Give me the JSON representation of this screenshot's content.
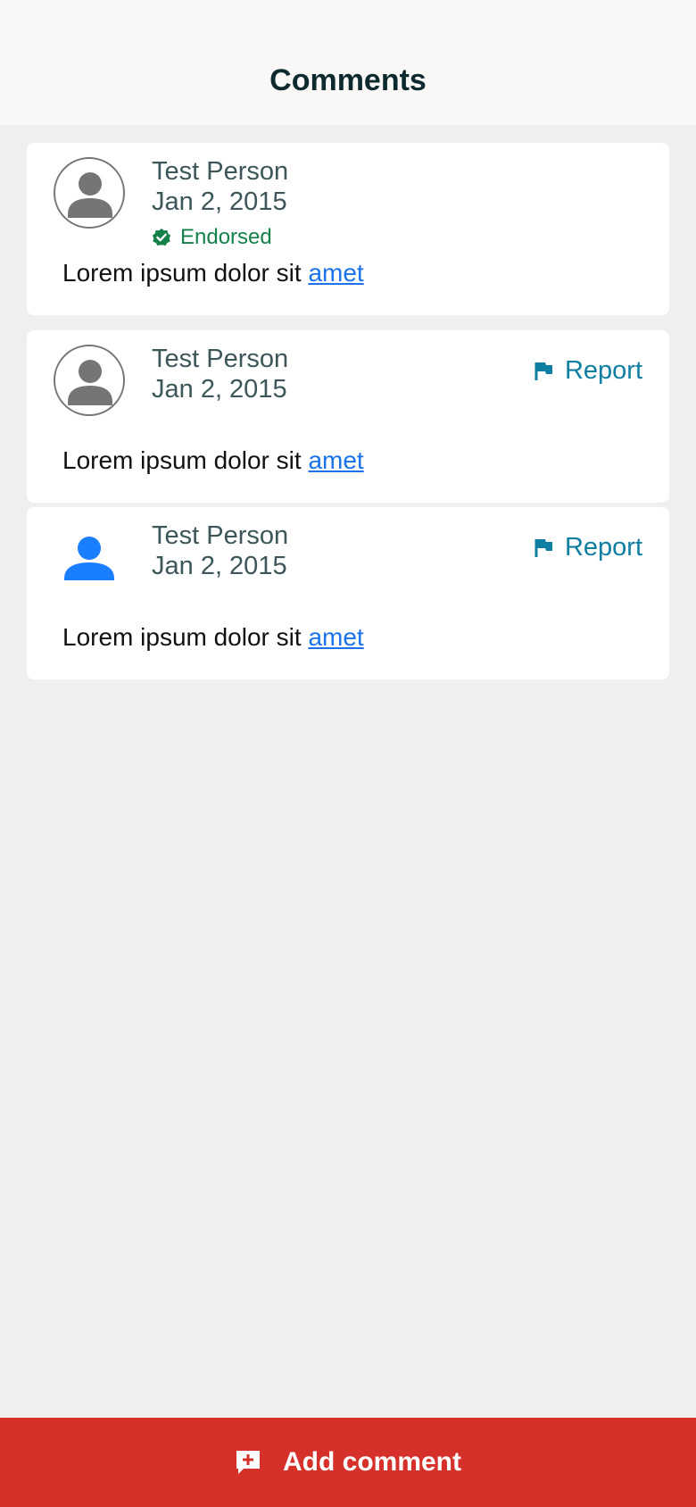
{
  "header": {
    "title": "Comments"
  },
  "comments": [
    {
      "author": "Test Person",
      "date": "Jan 2, 2015",
      "endorsed_label": "Endorsed",
      "body_prefix": "Lorem ipsum dolor sit ",
      "body_link": "amet"
    },
    {
      "author": "Test Person",
      "date": "Jan 2, 2015",
      "report_label": "Report",
      "body_prefix": "Lorem ipsum dolor sit ",
      "body_link": "amet"
    },
    {
      "author": "Test Person",
      "date": "Jan 2, 2015",
      "report_label": "Report",
      "body_prefix": "Lorem ipsum dolor sit ",
      "body_link": "amet"
    }
  ],
  "footer": {
    "add_label": "Add comment"
  },
  "icons": {
    "avatar": "person-icon",
    "endorsed": "verified-check-icon",
    "report": "flag-icon",
    "add": "add-comment-icon"
  },
  "colors": {
    "endorsed": "#14804a",
    "report": "#0f7ea3",
    "link": "#1a73e8",
    "add_bar": "#d5302a",
    "avatar_gray": "#757575",
    "avatar_blue": "#1a7fff"
  }
}
